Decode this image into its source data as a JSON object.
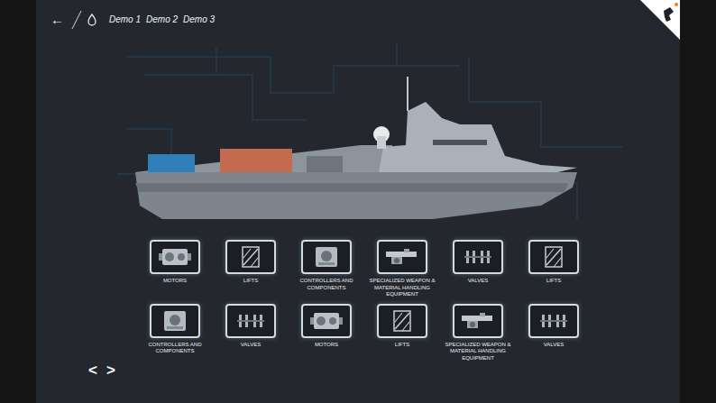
{
  "nav": {
    "back": "←",
    "tabs": [
      "Demo 1",
      "Demo 2",
      "Demo 3"
    ]
  },
  "categories": [
    {
      "label": "MOTORS",
      "kind": "motor"
    },
    {
      "label": "LIFTS",
      "kind": "lift"
    },
    {
      "label": "CONTROLLERS AND COMPONENTS",
      "kind": "controller"
    },
    {
      "label": "SPECIALIZED WEAPON & MATERIAL HANDLING EQUIPMENT",
      "kind": "weapon"
    },
    {
      "label": "VALVES",
      "kind": "valve"
    },
    {
      "label": "LIFTS",
      "kind": "lift"
    },
    {
      "label": "CONTROLLERS AND COMPONENTS",
      "kind": "controller"
    },
    {
      "label": "VALVES",
      "kind": "valve"
    },
    {
      "label": "MOTORS",
      "kind": "motor"
    },
    {
      "label": "LIFTS",
      "kind": "lift"
    },
    {
      "label": "SPECIALIZED WEAPON & MATERIAL HANDLING EQUIPMENT",
      "kind": "weapon"
    },
    {
      "label": "VALVES",
      "kind": "valve"
    }
  ],
  "pager": {
    "prev": "<",
    "next": ">"
  }
}
